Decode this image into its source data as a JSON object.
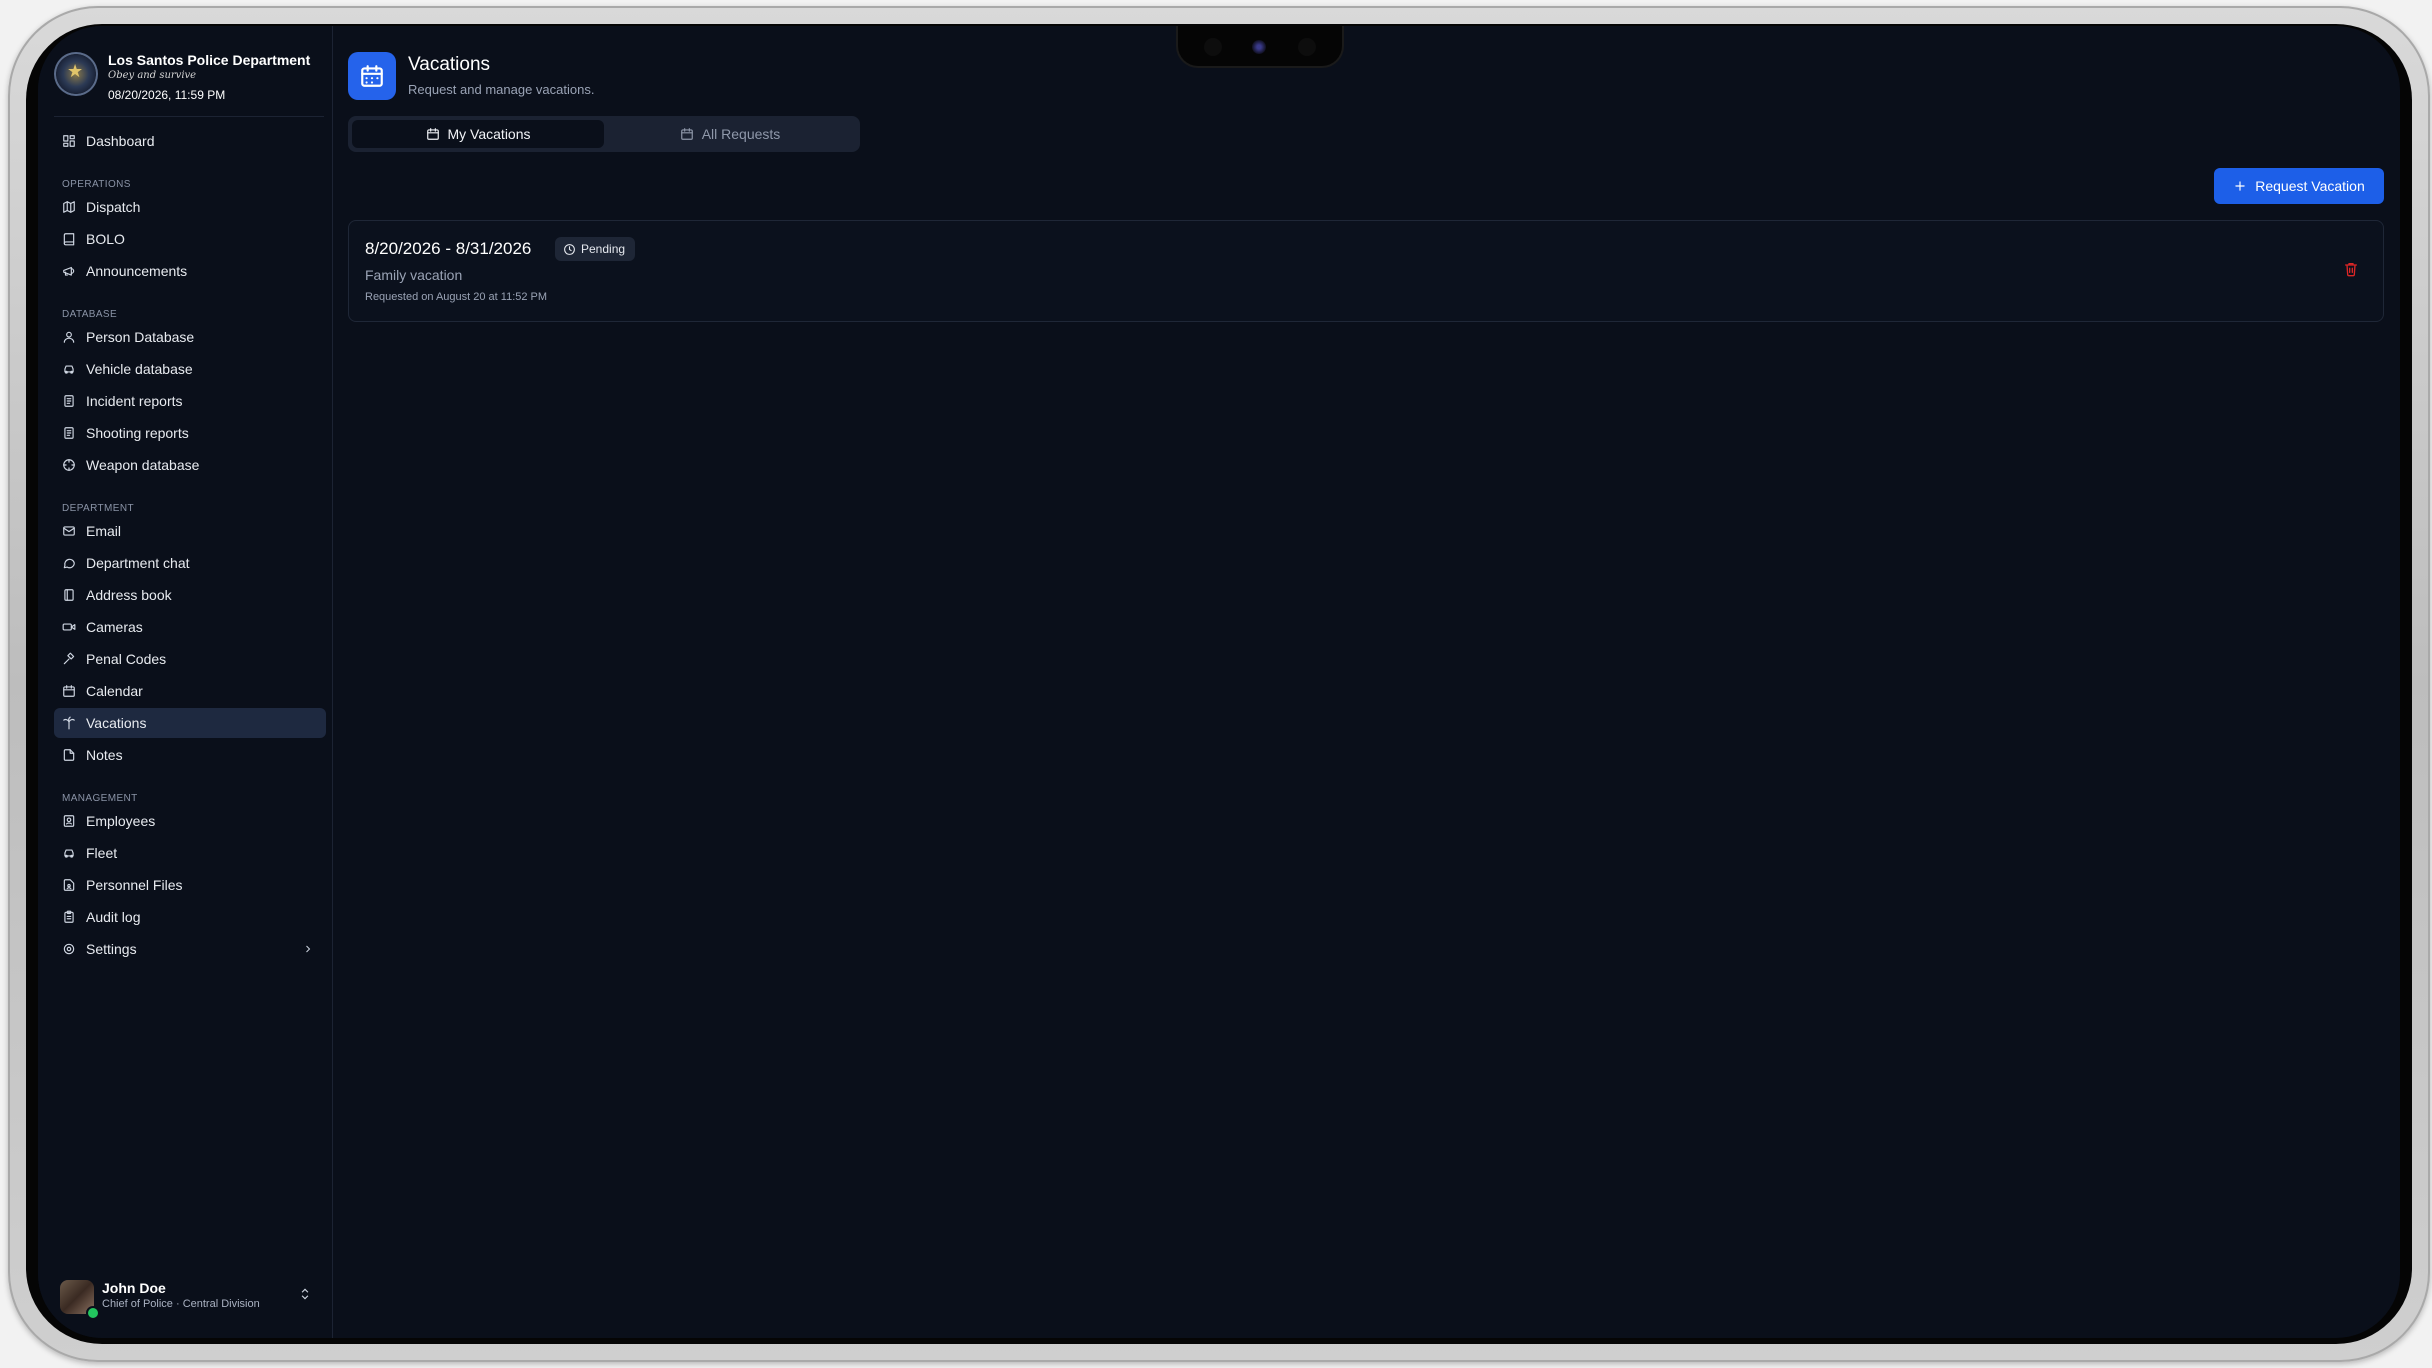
{
  "brand": {
    "name": "Los Santos Police Department",
    "motto": "Obey and survive",
    "datetime": "08/20/2026, 11:59 PM"
  },
  "nav": {
    "dashboard": "Dashboard",
    "sections": {
      "operations": "OPERATIONS",
      "database": "DATABASE",
      "department": "DEPARTMENT",
      "management": "MANAGEMENT"
    },
    "items": {
      "dispatch": "Dispatch",
      "bolo": "BOLO",
      "announcements": "Announcements",
      "person_database": "Person Database",
      "vehicle_database": "Vehicle database",
      "incident_reports": "Incident reports",
      "shooting_reports": "Shooting reports",
      "weapon_database": "Weapon database",
      "email": "Email",
      "department_chat": "Department chat",
      "address_book": "Address book",
      "cameras": "Cameras",
      "penal_codes": "Penal Codes",
      "calendar": "Calendar",
      "vacations": "Vacations",
      "notes": "Notes",
      "employees": "Employees",
      "fleet": "Fleet",
      "personnel_files": "Personnel Files",
      "audit_log": "Audit log",
      "settings": "Settings"
    },
    "active": "vacations"
  },
  "user": {
    "name": "John Doe",
    "role": "Chief of Police · Central Division",
    "status_color": "#22c55e"
  },
  "page": {
    "title": "Vacations",
    "subtitle": "Request and manage vacations.",
    "icon": "calendar-icon"
  },
  "tabs": {
    "my": "My Vacations",
    "all": "All Requests",
    "selected": "my"
  },
  "actions": {
    "request": "Request Vacation"
  },
  "vacations": [
    {
      "dates": "8/20/2026 - 8/31/2026",
      "status": "Pending",
      "reason": "Family vacation",
      "requested": "Requested on August 20 at 11:52 PM"
    }
  ],
  "colors": {
    "background": "#0a0f1a",
    "accent": "#2563eb",
    "active_nav": "#1e2940",
    "danger": "#dc2626"
  }
}
